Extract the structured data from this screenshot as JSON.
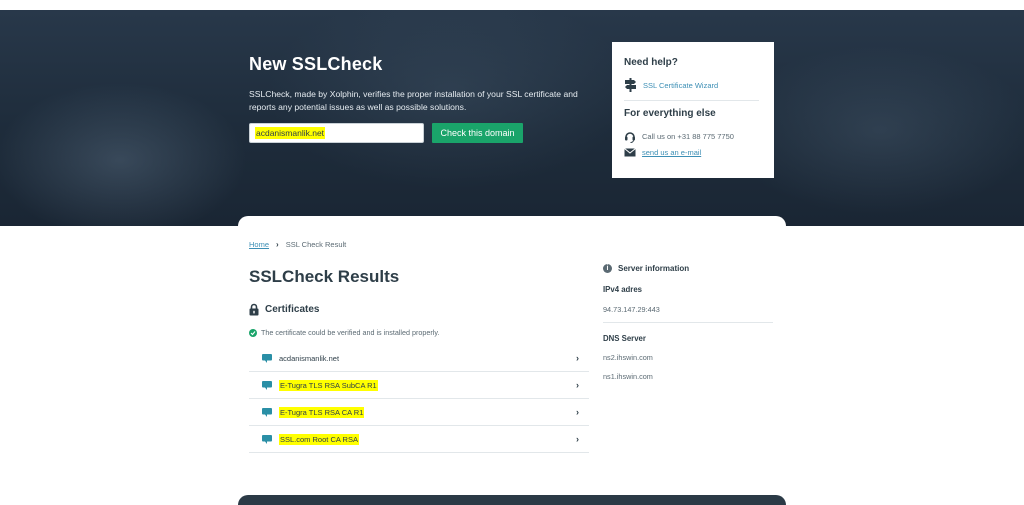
{
  "hero": {
    "title": "New SSLCheck",
    "description": "SSLCheck, made by Xolphin, verifies the proper installation of your SSL certificate and reports any potential issues as well as possible solutions.",
    "domain_value": "acdanismanlik.net",
    "check_button": "Check this domain"
  },
  "help": {
    "title": "Need help?",
    "wizard_link": "SSL Certificate Wizard",
    "else_title": "For everything else",
    "call_text": "Call us on +31 88 775 7750",
    "email_link": "send us an e-mail"
  },
  "breadcrumb": {
    "home": "Home",
    "current": "SSL Check Result"
  },
  "results": {
    "title": "SSLCheck Results",
    "certificates_heading": "Certificates",
    "verified_text": "The certificate could be verified and is installed properly.",
    "certs": [
      {
        "name": "acdanismanlik.net",
        "highlighted": false
      },
      {
        "name": "E-Tugra TLS RSA SubCA R1",
        "highlighted": true
      },
      {
        "name": "E-Tugra TLS RSA CA R1",
        "highlighted": true
      },
      {
        "name": "SSL.com Root CA RSA",
        "highlighted": true
      }
    ]
  },
  "server": {
    "heading": "Server information",
    "ipv4_label": "IPv4 adres",
    "ipv4_value": "94.73.147.29:443",
    "dns_label": "DNS Server",
    "dns_values": [
      "ns2.ihswin.com",
      "ns1.ihswin.com"
    ]
  },
  "colors": {
    "accent_green": "#1aa46a",
    "link_blue": "#3d8fb5",
    "hero_dark": "#1e2c3b",
    "highlight": "#ffff00"
  }
}
